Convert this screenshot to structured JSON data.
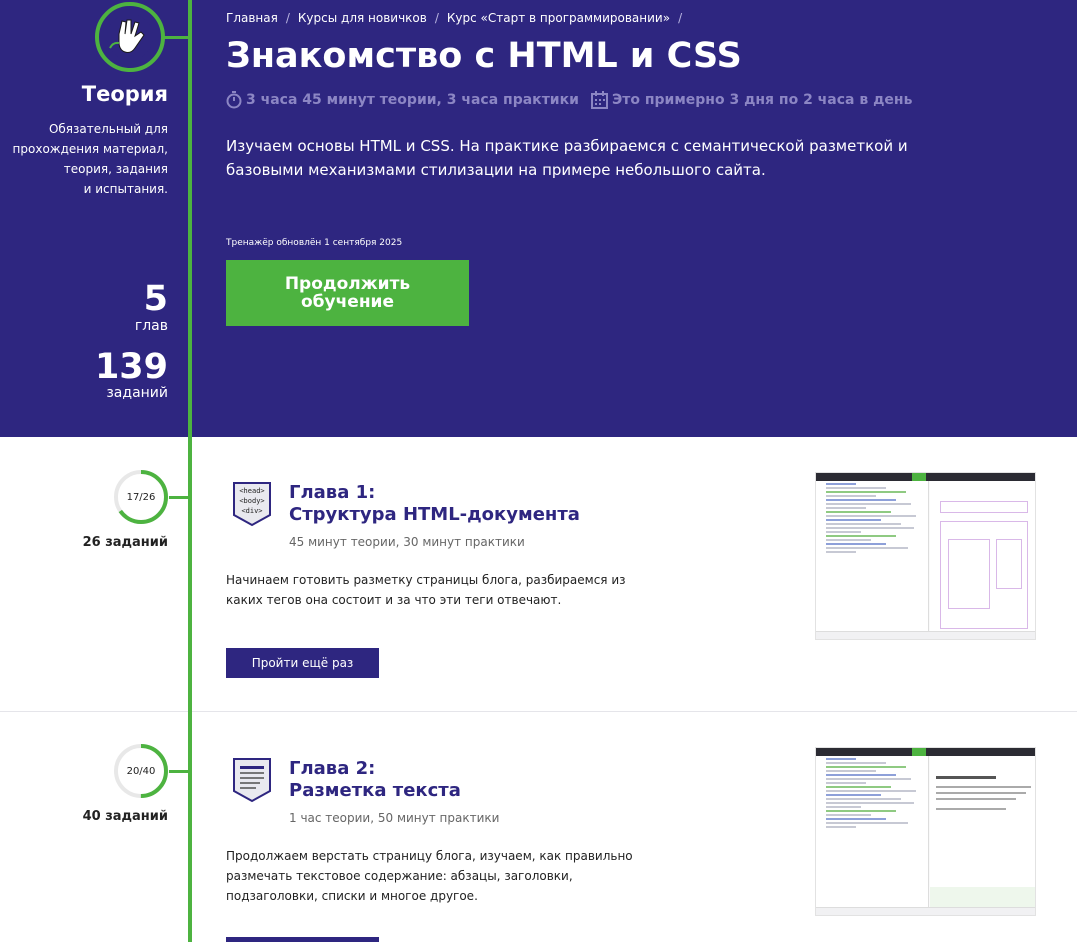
{
  "colors": {
    "hero_bg": "#2e2680",
    "accent_green": "#4db340",
    "chapter_title": "#2e2680"
  },
  "mode": {
    "icon": "vulcan-salute-hand-icon",
    "title": "Теория",
    "description": [
      "Обязательный для",
      "прохождения материал,",
      "теория, задания",
      "и испытания."
    ]
  },
  "stats": {
    "chapters_count": "5",
    "chapters_label": "глав",
    "tasks_count": "139",
    "tasks_label": "заданий"
  },
  "breadcrumb": [
    "Главная",
    "Курсы для новичков",
    "Курс «Старт в программировании»"
  ],
  "course": {
    "title": "Знакомство с HTML и CSS",
    "duration": "3 часа 45 минут теории, 3 часа практики",
    "schedule": "Это примерно 3 дня по 2 часа в день",
    "description": "Изучаем основы HTML и CSS. На практике разбираемся с семантической разметкой и базовыми механизмами стилизации на примере небольшого сайта.",
    "updated": "Тренажёр обновлён 1 сентября 2025",
    "continue_label": "Продолжить обучение"
  },
  "chapters": [
    {
      "progress_text": "17/26",
      "progress_fraction": 0.654,
      "tasks": "26 заданий",
      "badge_icon": "html-tags-badge-icon",
      "badge_lines": [
        "<head>",
        "<body>",
        "<div>"
      ],
      "title_line1": "Глава 1:",
      "title_line2": "Структура HTML-документа",
      "time": "45 минут теории, 30 минут практики",
      "description": "Начинаем готовить разметку страницы блога, разбираемся из каких тегов она состоит и за что эти теги отвечают.",
      "button_label": "Пройти ещё раз",
      "preview_icon": "editor-preview-screenshot"
    },
    {
      "progress_text": "20/40",
      "progress_fraction": 0.5,
      "tasks": "40 заданий",
      "badge_icon": "text-document-badge-icon",
      "title_line1": "Глава 2:",
      "title_line2": "Разметка текста",
      "time": "1 час теории, 50 минут практики",
      "description": "Продолжаем верстать страницу блога, изучаем, как правильно размечать текстовое содержание: абзацы, заголовки, подзаголовки, списки и многое другое.",
      "button_label": "",
      "preview_icon": "editor-preview-screenshot"
    }
  ]
}
